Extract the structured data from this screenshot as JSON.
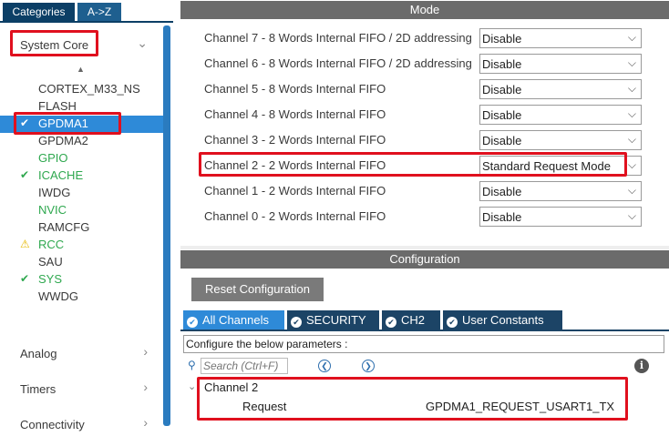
{
  "left_panel": {
    "tabs": {
      "categories": "Categories",
      "az": "A->Z"
    },
    "system_core": "System Core",
    "items": [
      {
        "label": "CORTEX_M33_NS",
        "status": "none"
      },
      {
        "label": "FLASH",
        "status": "none"
      },
      {
        "label": "GPDMA1",
        "status": "ok-selected"
      },
      {
        "label": "GPDMA2",
        "status": "none"
      },
      {
        "label": "GPIO",
        "status": "green"
      },
      {
        "label": "ICACHE",
        "status": "ok"
      },
      {
        "label": "IWDG",
        "status": "none"
      },
      {
        "label": "NVIC",
        "status": "green"
      },
      {
        "label": "RAMCFG",
        "status": "none"
      },
      {
        "label": "RCC",
        "status": "warning"
      },
      {
        "label": "SAU",
        "status": "none"
      },
      {
        "label": "SYS",
        "status": "ok"
      },
      {
        "label": "WWDG",
        "status": "none"
      }
    ],
    "analog": "Analog",
    "timers": "Timers",
    "connectivity": "Connectivity"
  },
  "mode": {
    "header": "Mode",
    "rows": [
      {
        "label": "Channel 7  - 8 Words Internal FIFO / 2D addressing",
        "value": "Disable"
      },
      {
        "label": "Channel 6  - 8 Words Internal FIFO / 2D addressing",
        "value": "Disable"
      },
      {
        "label": "Channel 5  - 8 Words Internal FIFO",
        "value": "Disable"
      },
      {
        "label": "Channel 4  - 8 Words Internal FIFO",
        "value": "Disable"
      },
      {
        "label": "Channel 3  - 2 Words Internal FIFO",
        "value": "Disable"
      },
      {
        "label": "Channel 2  - 2 Words Internal FIFO",
        "value": "Standard Request Mode"
      },
      {
        "label": "Channel 1  - 2 Words Internal FIFO",
        "value": "Disable"
      },
      {
        "label": "Channel 0  - 2 Words Internal FIFO",
        "value": "Disable"
      }
    ]
  },
  "config": {
    "header": "Configuration",
    "reset_label": "Reset Configuration",
    "tabs": [
      "All Channels",
      "SECURITY",
      "CH2",
      "User Constants"
    ],
    "params_text": "Configure the below parameters :",
    "search_placeholder": "Search (Ctrl+F)",
    "tree_node": "Channel 2",
    "request_label": "Request",
    "request_value": "GPDMA1_REQUEST_USART1_TX"
  }
}
